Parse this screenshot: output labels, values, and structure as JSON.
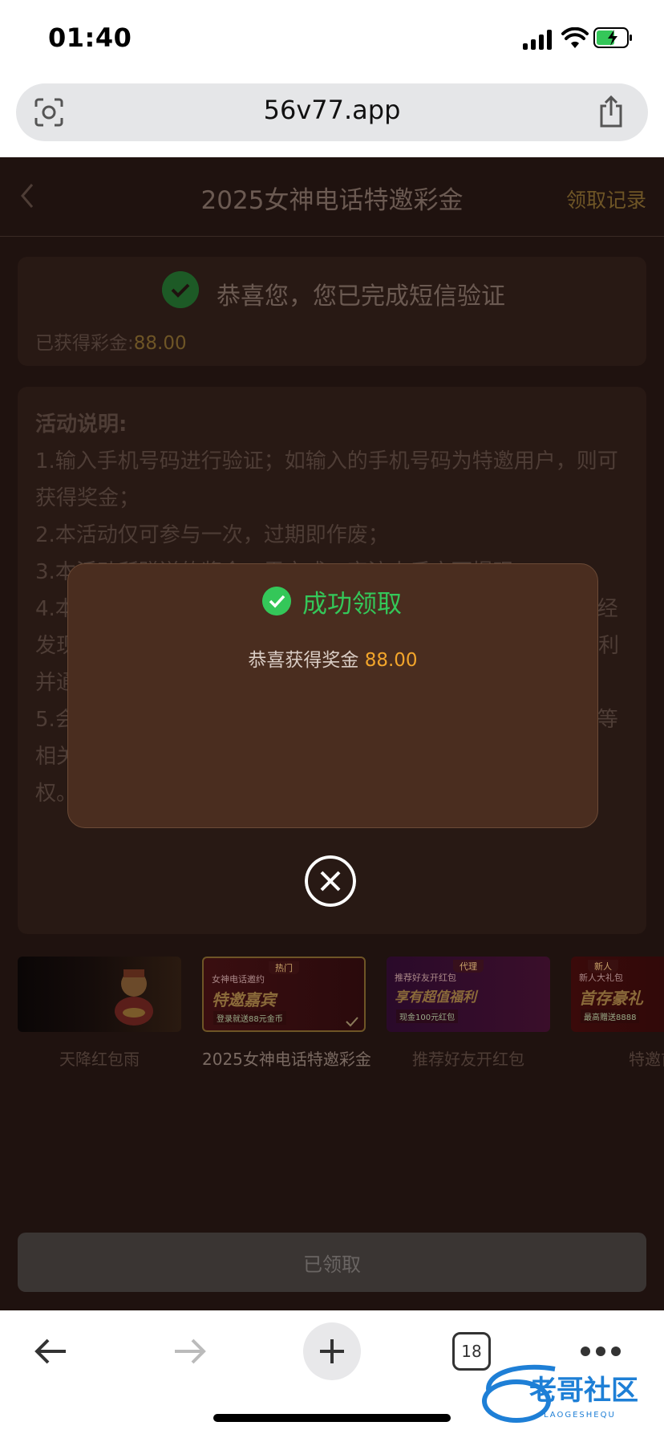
{
  "status_bar": {
    "time": "01:40",
    "battery_color": "#34c759"
  },
  "browser": {
    "url": "56v77.app",
    "tab_count": "18"
  },
  "header": {
    "title": "2025女神电话特邀彩金",
    "records_link": "领取记录"
  },
  "verify_card": {
    "message": "恭喜您，您已完成短信验证",
    "got_label": "已获得彩金:",
    "got_value": "88.00"
  },
  "rules": {
    "title": "活动说明:",
    "items": [
      "1.输入手机号码进行验证；如输入的手机号码为特邀用户，则可获得奖金；",
      "2.本活动仅可参与一次，过期即作废；",
      "3.本活动所赠送的奖金，需完成一定流水后方可提现，",
      "4.本活动仅限平台真实会员参与，严禁利用技术手段套利，一经发现立即冻结账户并暂停发放，平台保留对违规行为的处理权利并通知",
      "5.会员参与该活动时，本平台将默认会员同意且遵守对应条件等相关规定，为避免文字理解歧义，本平台保有本活动最终解释权。"
    ]
  },
  "carousel": [
    {
      "caption": "天降红包雨",
      "tag": "",
      "line1": "",
      "line2": "",
      "line3": "",
      "active": false
    },
    {
      "caption": "2025女神电话特邀彩金",
      "tag": "热门",
      "line1": "女神电话邀约",
      "line2": "特邀嘉宾",
      "line3": "登录就送88元金币",
      "active": true
    },
    {
      "caption": "推荐好友开红包",
      "tag": "代理",
      "line1": "推荐好友开红包",
      "line2": "享有超值福利",
      "line3": "现金100元红包",
      "active": false
    },
    {
      "caption": "特邀首",
      "tag": "新人",
      "line1": "新人大礼包",
      "line2": "首存豪礼",
      "line3": "最高赠送8888",
      "active": false
    }
  ],
  "claim_button": {
    "label": "已领取"
  },
  "modal": {
    "title": "成功领取",
    "message": "恭喜获得奖金",
    "amount": "88.00",
    "accent_color": "#34c759",
    "amount_color": "#f2a52b"
  },
  "watermark": {
    "title": "老哥社区",
    "subtitle": "LAOGESHEQU"
  }
}
